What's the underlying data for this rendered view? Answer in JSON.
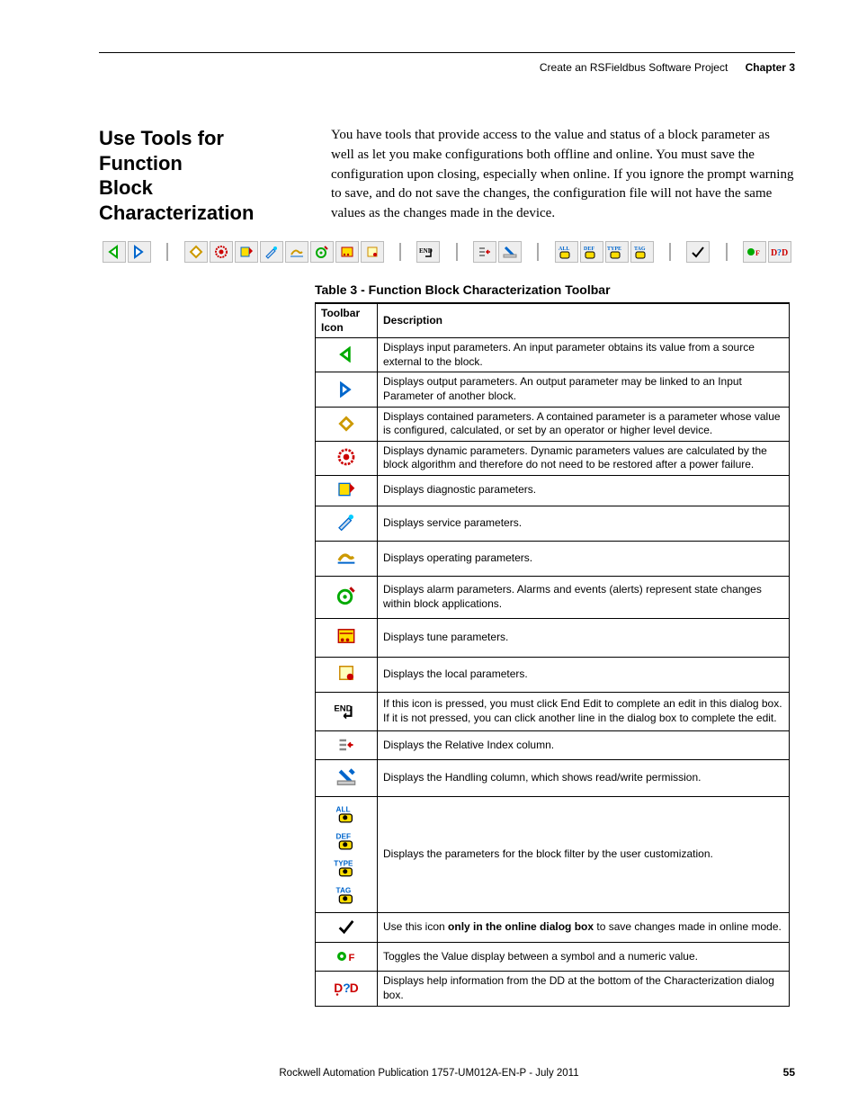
{
  "header": {
    "title": "Create an RSFieldbus Software Project",
    "chapter": "Chapter 3"
  },
  "section_title_line1": "Use Tools for Function",
  "section_title_line2": "Block Characterization",
  "intro_paragraph": "You have tools that provide access to the value and status of a block parameter as well as let you make configurations both offline and online. You must save the configuration upon closing, especially when online. If you ignore the prompt warning to save, and do not save the changes, the configuration file will not have the same values as the changes made in the device.",
  "table_caption": "Table 3 - Function Block Characterization Toolbar",
  "table": {
    "headers": [
      "Toolbar Icon",
      "Description"
    ],
    "rows": [
      {
        "icon": "input-param-icon",
        "desc": "Displays input parameters. An input parameter obtains its value from a source external to the block."
      },
      {
        "icon": "output-param-icon",
        "desc": "Displays output parameters. An output parameter may be linked to an Input Parameter of another block."
      },
      {
        "icon": "contained-param-icon",
        "desc": "Displays contained parameters. A contained parameter is a parameter whose value is configured, calculated, or set by an operator or higher level device."
      },
      {
        "icon": "dynamic-param-icon",
        "desc": "Displays dynamic parameters. Dynamic parameters values are calculated by the block algorithm and therefore do not need to be restored after a power failure."
      },
      {
        "icon": "diagnostic-param-icon",
        "desc": "Displays diagnostic parameters."
      },
      {
        "icon": "service-param-icon",
        "desc": "Displays service parameters."
      },
      {
        "icon": "operating-param-icon",
        "desc": "Displays operating parameters."
      },
      {
        "icon": "alarm-param-icon",
        "desc": "Displays alarm parameters. Alarms and events (alerts) represent state changes within block applications."
      },
      {
        "icon": "tune-param-icon",
        "desc": "Displays tune parameters."
      },
      {
        "icon": "local-param-icon",
        "desc": "Displays the local parameters."
      },
      {
        "icon": "end-edit-icon",
        "desc": "If this icon is pressed, you must click End Edit to complete an edit in this dialog box. If it is not pressed, you can click another line in the dialog box to complete the edit."
      },
      {
        "icon": "relative-index-icon",
        "desc": "Displays the Relative Index column."
      },
      {
        "icon": "handling-column-icon",
        "desc": "Displays the Handling column, which shows read/write permission."
      },
      {
        "icon": "filter-group-icons",
        "desc": "Displays the parameters for the block filter by the user customization."
      },
      {
        "icon": "save-online-icon",
        "desc_prefix": " Use this icon ",
        "desc_bold": "only in the online dialog box",
        "desc_suffix": " to save changes made in online mode."
      },
      {
        "icon": "toggle-value-icon",
        "desc": "Toggles the Value display between a symbol and a numeric value."
      },
      {
        "icon": "dd-help-icon",
        "desc": "Displays help information from the DD at the bottom of the Characterization dialog box."
      }
    ]
  },
  "filter_labels": [
    "ALL",
    "DEF",
    "TYPE",
    "TAG"
  ],
  "footer": "Rockwell Automation Publication 1757-UM012A-EN-P - July 2011",
  "page_number": "55"
}
